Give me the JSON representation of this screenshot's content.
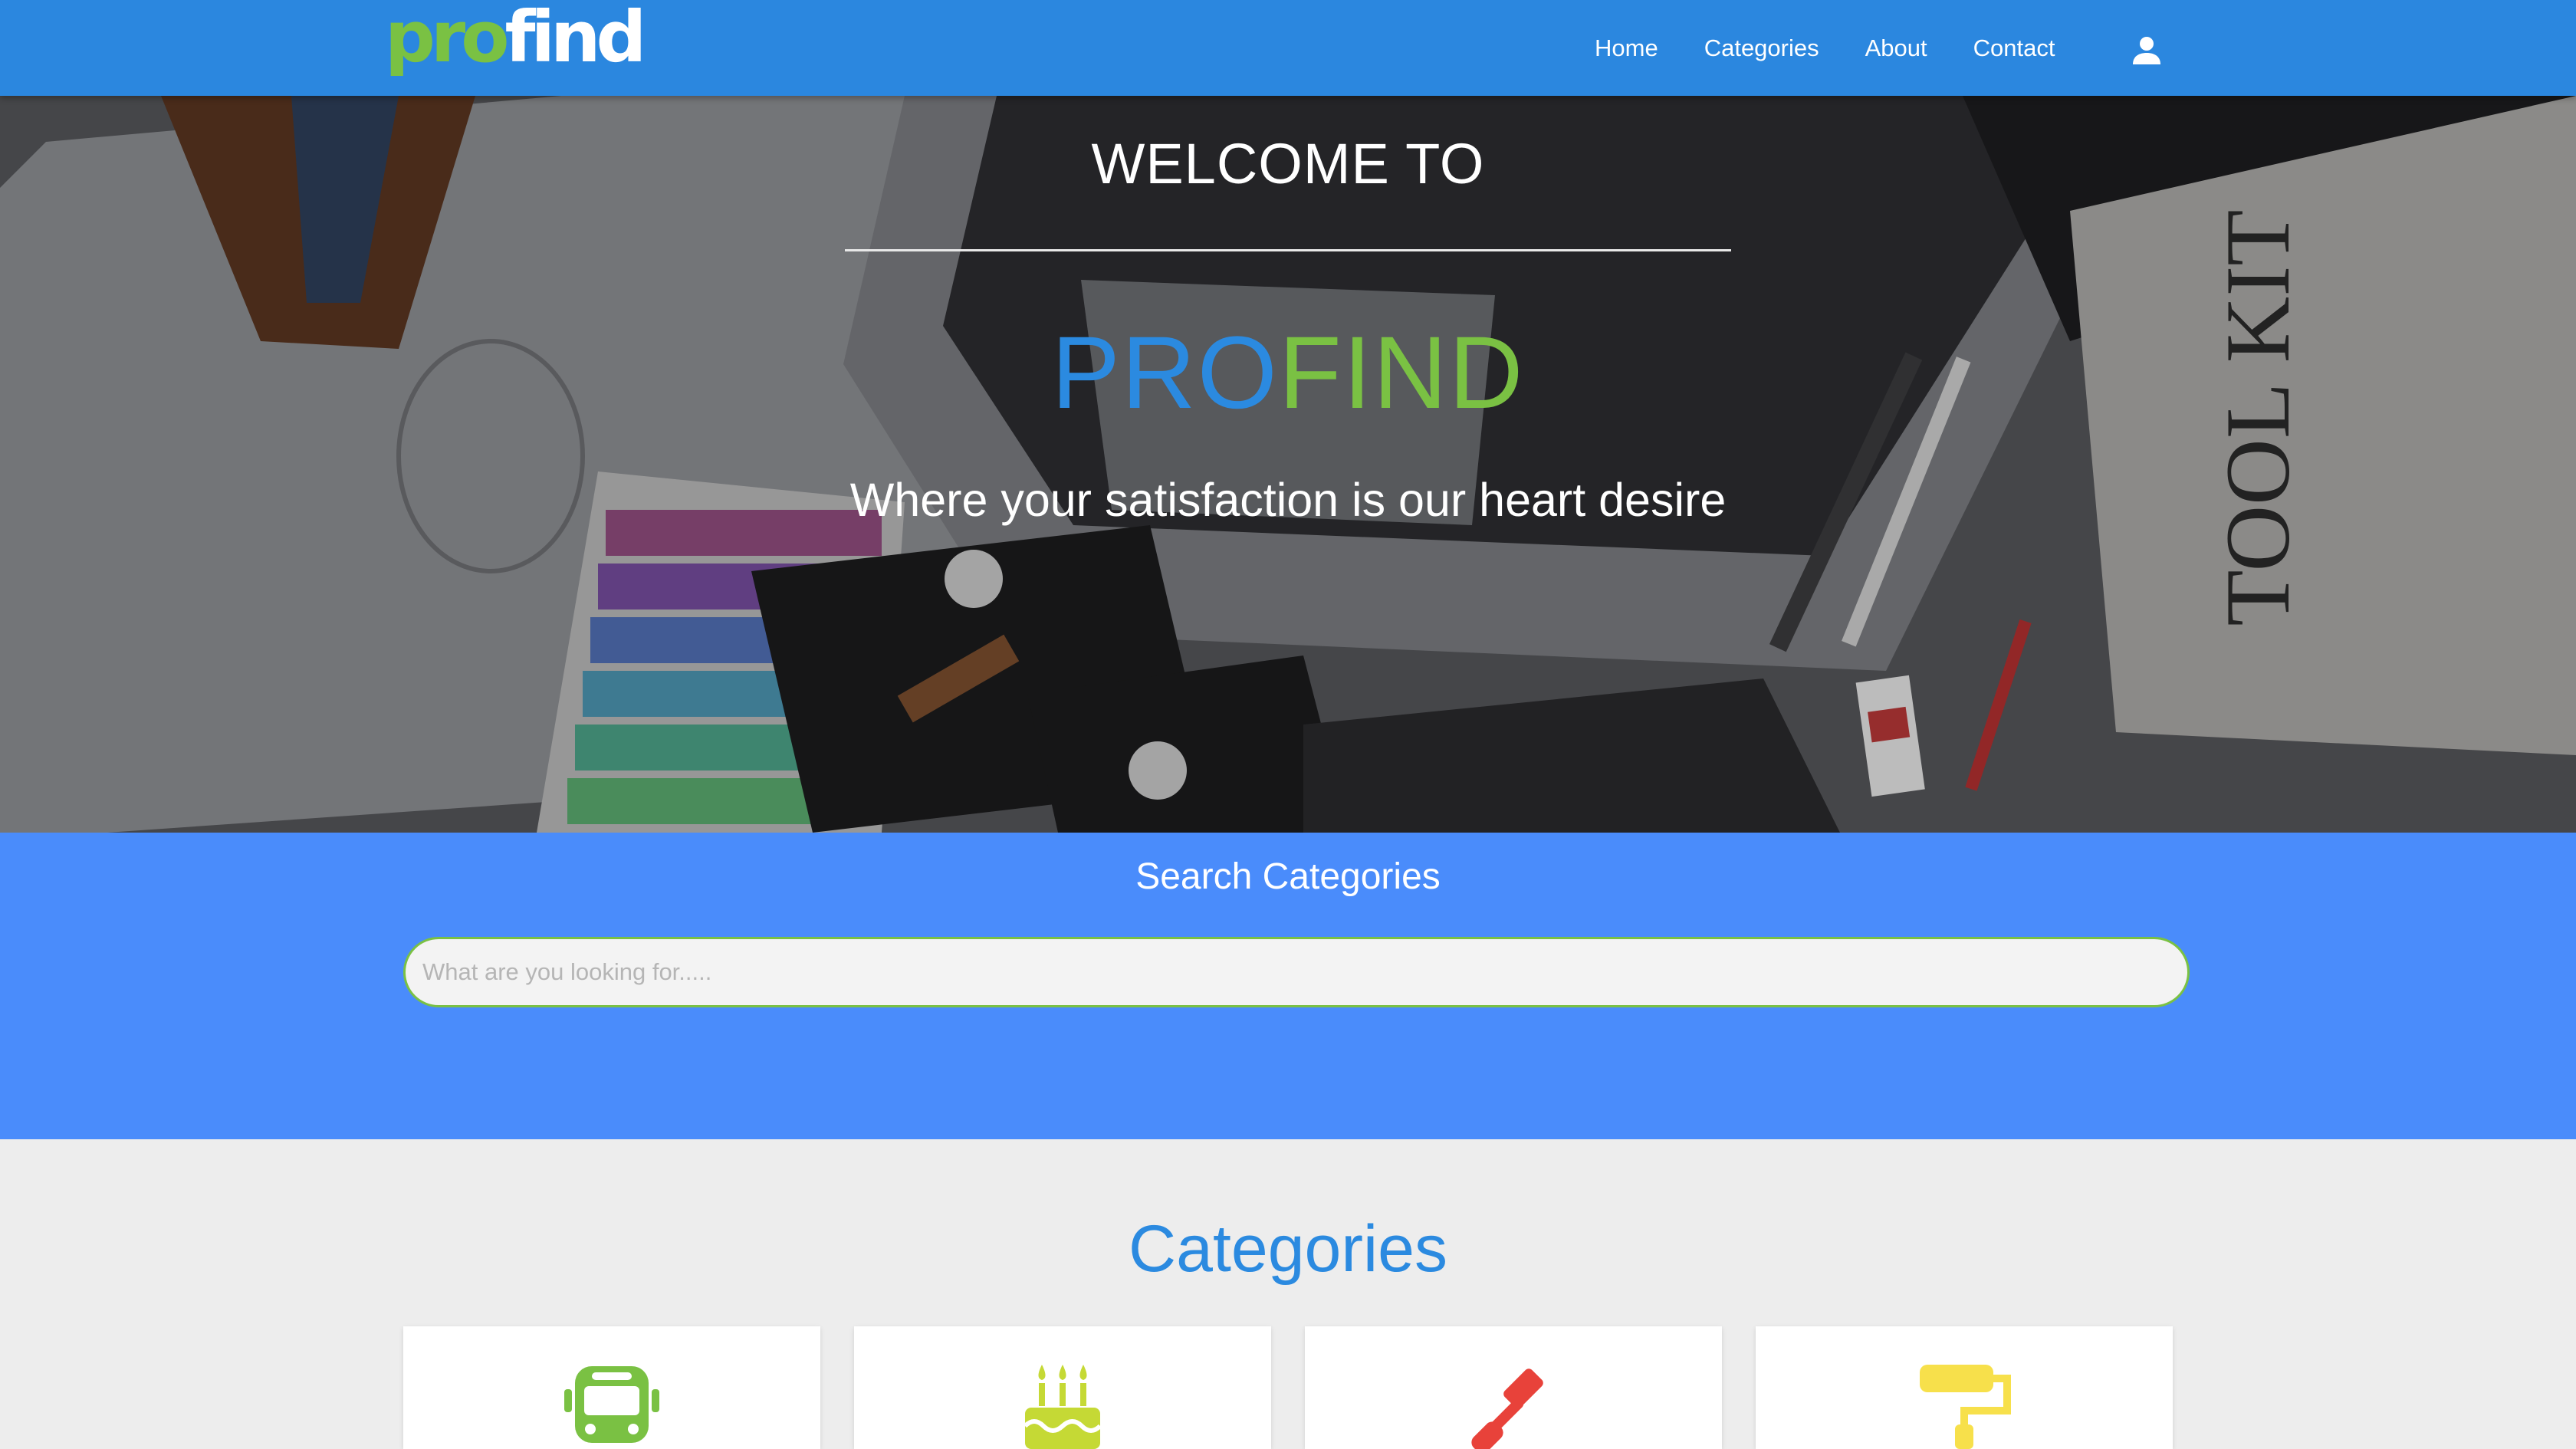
{
  "brand": {
    "logo_pro": "pro",
    "logo_find": "find",
    "pro_color": "#7ac143",
    "find_color": "#ffffff"
  },
  "nav": {
    "background": "#2b87df",
    "links": [
      "Home",
      "Categories",
      "About",
      "Contact"
    ],
    "user_icon": "user-icon"
  },
  "hero": {
    "welcome": "WELCOME TO",
    "brand_pro": "PRO",
    "brand_find": "FIND",
    "tagline": "Where your satisfaction is our heart desire"
  },
  "search": {
    "title": "Search Categories",
    "placeholder": "What are you looking for.....",
    "value": "",
    "background": "#4a8cfb"
  },
  "categories": {
    "title": "Categories",
    "cards": [
      {
        "icon": "bus-icon",
        "color": "#7ac143"
      },
      {
        "icon": "birthday-cake-icon",
        "color": "#c5d935"
      },
      {
        "icon": "screwdriver-icon",
        "color": "#e8423a"
      },
      {
        "icon": "paint-roller-icon",
        "color": "#f7e04b"
      }
    ]
  }
}
